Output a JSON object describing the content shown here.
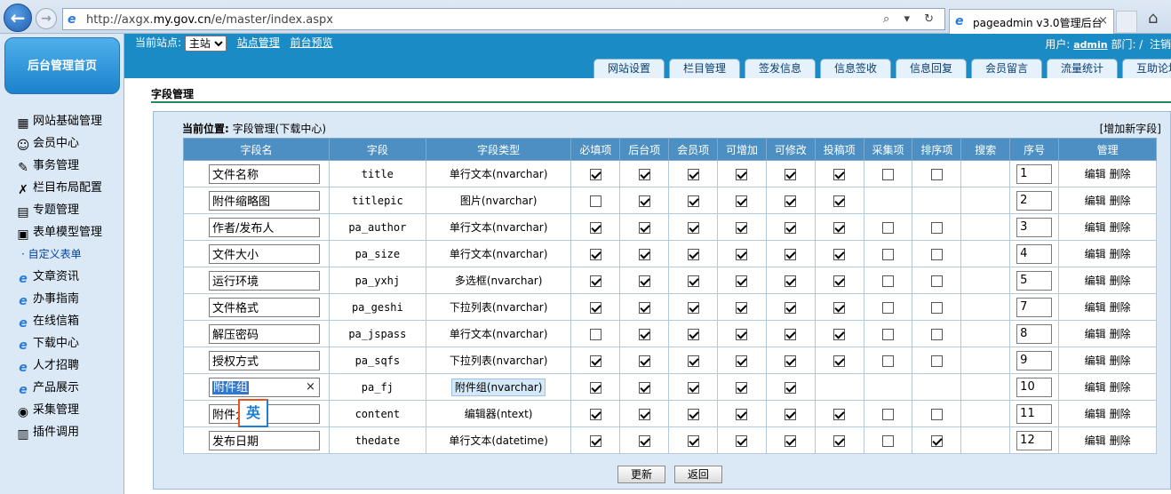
{
  "browser": {
    "url_prefix": "http://axgx.",
    "url_domain": "my.gov.cn",
    "url_path": "/e/master/index.aspx",
    "addr_tools": "⌕ ▾ ↻",
    "tab_title": "pageadmin v3.0管理后台",
    "tab_close": "×"
  },
  "sidebar": {
    "home_button": "后台管理首页",
    "items": [
      {
        "label": "网站基础管理",
        "icon": "site-icon",
        "glyph": "▦"
      },
      {
        "label": "会员中心",
        "icon": "members-icon",
        "glyph": "☺"
      },
      {
        "label": "事务管理",
        "icon": "affairs-icon",
        "glyph": "✎"
      },
      {
        "label": "栏目布局配置",
        "icon": "tools-icon",
        "glyph": "✗"
      },
      {
        "label": "专题管理",
        "icon": "topic-icon",
        "glyph": "▤"
      },
      {
        "label": "表单模型管理",
        "icon": "form-model-icon",
        "glyph": "▣"
      },
      {
        "label": "自定义表单",
        "sub": true
      },
      {
        "label": "文章资讯",
        "icon": "ie-icon",
        "glyph": "e"
      },
      {
        "label": "办事指南",
        "icon": "ie-icon",
        "glyph": "e"
      },
      {
        "label": "在线信箱",
        "icon": "ie-icon",
        "glyph": "e"
      },
      {
        "label": "下载中心",
        "icon": "ie-icon",
        "glyph": "e"
      },
      {
        "label": "人才招聘",
        "icon": "ie-icon",
        "glyph": "e"
      },
      {
        "label": "产品展示",
        "icon": "ie-icon",
        "glyph": "e"
      },
      {
        "label": "采集管理",
        "icon": "collect-icon",
        "glyph": "◉"
      },
      {
        "label": "插件调用",
        "icon": "plugin-icon",
        "glyph": "▥"
      }
    ]
  },
  "header": {
    "site_label": "当前站点:",
    "site_value": "主站",
    "site_manage": "站点管理",
    "front_preview": "前台预览",
    "user_label": "用户:",
    "user_name": "admin",
    "dept_label": "部门: /",
    "logout": "注销",
    "tabs": [
      "网站设置",
      "栏目管理",
      "签发信息",
      "信息签收",
      "信息回复",
      "会员留言",
      "流量统计",
      "互助论坛"
    ]
  },
  "main": {
    "page_title": "字段管理",
    "crumb_label": "当前位置:",
    "crumb_value": "字段管理(下载中心)",
    "add_field": "[增加新字段]",
    "columns": [
      "字段名",
      "字段",
      "字段类型",
      "必填项",
      "后台项",
      "会员项",
      "可增加",
      "可修改",
      "投稿项",
      "采集项",
      "排序项",
      "搜索",
      "序号",
      "管理"
    ],
    "rows": [
      {
        "name": "文件名称",
        "field": "title",
        "type": "单行文本(nvarchar)",
        "checks": [
          1,
          1,
          1,
          1,
          1,
          1,
          0,
          0,
          null
        ],
        "order": "1"
      },
      {
        "name": "附件缩略图",
        "field": "titlepic",
        "type": "图片(nvarchar)",
        "checks": [
          0,
          1,
          1,
          1,
          1,
          1,
          null,
          null,
          null
        ],
        "order": "2"
      },
      {
        "name": "作者/发布人",
        "field": "pa_author",
        "type": "单行文本(nvarchar)",
        "checks": [
          1,
          1,
          1,
          1,
          1,
          1,
          0,
          0,
          null
        ],
        "order": "3"
      },
      {
        "name": "文件大小",
        "field": "pa_size",
        "type": "单行文本(nvarchar)",
        "checks": [
          1,
          1,
          1,
          1,
          1,
          1,
          0,
          0,
          null
        ],
        "order": "4"
      },
      {
        "name": "运行环境",
        "field": "pa_yxhj",
        "type": "多选框(nvarchar)",
        "checks": [
          1,
          1,
          1,
          1,
          1,
          1,
          0,
          0,
          null
        ],
        "order": "5"
      },
      {
        "name": "文件格式",
        "field": "pa_geshi",
        "type": "下拉列表(nvarchar)",
        "checks": [
          1,
          1,
          1,
          1,
          1,
          1,
          0,
          0,
          null
        ],
        "order": "7"
      },
      {
        "name": "解压密码",
        "field": "pa_jspass",
        "type": "单行文本(nvarchar)",
        "checks": [
          0,
          1,
          1,
          1,
          1,
          1,
          0,
          0,
          null
        ],
        "order": "8"
      },
      {
        "name": "授权方式",
        "field": "pa_sqfs",
        "type": "下拉列表(nvarchar)",
        "checks": [
          1,
          1,
          1,
          1,
          1,
          1,
          0,
          0,
          null
        ],
        "order": "9"
      },
      {
        "name": "附件组",
        "field": "pa_fj",
        "type": "附件组(nvarchar)",
        "checks": [
          1,
          1,
          1,
          1,
          1,
          null,
          null,
          null,
          null
        ],
        "order": "10"
      },
      {
        "name": "附件介绍",
        "field": "content",
        "type": "编辑器(ntext)",
        "checks": [
          1,
          1,
          1,
          1,
          1,
          1,
          0,
          0,
          null
        ],
        "order": "11"
      },
      {
        "name": "发布日期",
        "field": "thedate",
        "type": "单行文本(datetime)",
        "checks": [
          1,
          1,
          1,
          1,
          1,
          1,
          0,
          1,
          null
        ],
        "order": "12"
      }
    ],
    "edit_label": "编辑",
    "delete_label": "删除",
    "update_button": "更新",
    "back_button": "返回",
    "ime_label": "英",
    "clear_glyph": "×"
  }
}
